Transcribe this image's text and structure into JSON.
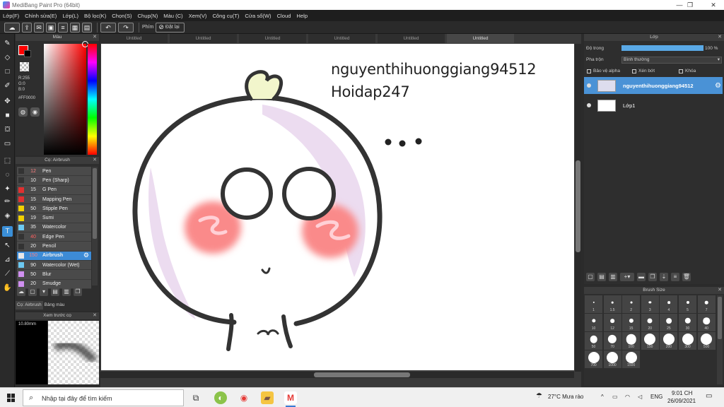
{
  "window": {
    "title": "MediBang Paint Pro (64bit)",
    "controls": [
      "—",
      "❐",
      "✕"
    ]
  },
  "menu": [
    "Lớp(F)",
    "Chỉnh sửa(E)",
    "Lớp(L)",
    "Bộ lọc(K)",
    "Chọn(S)",
    "Chụp(N)",
    "Màu (C)",
    "Xem(V)",
    "Công cụ(T)",
    "Cửa sổ(W)",
    "Cloud",
    "Help"
  ],
  "toolbar": {
    "hotkey_label": "Phím",
    "reset_label": "Đặt lại"
  },
  "color_panel": {
    "title": "Màu",
    "fg_color": "#ff0000",
    "bg_color": "#000000",
    "r": "R:255",
    "g": "G:0",
    "b": "B:0",
    "hex": "#FF0000"
  },
  "brush_panel": {
    "title": "Cọ: Airbrush",
    "brushes": [
      {
        "size": "12",
        "name": "Pen",
        "color": "#333333",
        "size_color": "#ff8080"
      },
      {
        "size": "10",
        "name": "Pen (Sharp)",
        "color": "#333333",
        "size_color": "#eeeeee"
      },
      {
        "size": "15",
        "name": "G Pen",
        "color": "#e03030",
        "size_color": "#eeeeee"
      },
      {
        "size": "15",
        "name": "Mapping Pen",
        "color": "#e03030",
        "size_color": "#eeeeee"
      },
      {
        "size": "50",
        "name": "Stipple Pen",
        "color": "#f0d000",
        "size_color": "#eeeeee"
      },
      {
        "size": "19",
        "name": "Sumi",
        "color": "#f0d000",
        "size_color": "#eeeeee"
      },
      {
        "size": "35",
        "name": "Watercolor",
        "color": "#6cc8f0",
        "size_color": "#eeeeee"
      },
      {
        "size": "40",
        "name": "Edge Pen",
        "color": "#333333",
        "size_color": "#ff6060"
      },
      {
        "size": "20",
        "name": "Pencil",
        "color": "#333333",
        "size_color": "#eeeeee"
      },
      {
        "size": "150",
        "name": "Airbrush",
        "color": "#e8e8e8",
        "size_color": "#ff8080"
      },
      {
        "size": "90",
        "name": "Watercolor (Wet)",
        "color": "#6cc8f0",
        "size_color": "#eeeeee"
      },
      {
        "size": "50",
        "name": "Blur",
        "color": "#d090f0",
        "size_color": "#eeeeee"
      },
      {
        "size": "20",
        "name": "Smudge",
        "color": "#d090f0",
        "size_color": "#eeeeee"
      }
    ],
    "tabs": [
      "Cọ: Airbrush",
      "Bảng màu"
    ]
  },
  "preview_panel": {
    "title": "Xem trước cọ",
    "size": "10.80mm"
  },
  "doc_tabs": [
    "Untitled",
    "Untitled",
    "Untitled",
    "Untitled",
    "Untitled",
    "Untitled"
  ],
  "canvas": {
    "text_line1": "nguyenthihuonggiang94512",
    "text_line2": "Hoidap247",
    "blush_color": "#fa8a8a",
    "stroke_color": "#333333",
    "shade_color": "#ead8ee"
  },
  "layer_panel": {
    "title": "Lớp",
    "opacity_label": "Độ trong",
    "opacity_value": "100 %",
    "opacity": 1.0,
    "blend_label": "Pha trộn",
    "blend_value": "Bình thường",
    "protect_alpha": "Bảo vệ alpha",
    "clipping": "Xén bớt",
    "lock": "Khóa",
    "layers": [
      {
        "name": "nguyenthihuonggiang94512",
        "selected": true
      },
      {
        "name": "Lớp1",
        "selected": false
      }
    ]
  },
  "brush_size_panel": {
    "title": "Brush Size",
    "sizes": [
      "1",
      "1.5",
      "2",
      "3",
      "4",
      "5",
      "7",
      "10",
      "12",
      "15",
      "20",
      "25",
      "30",
      "40",
      "50",
      "70",
      "100",
      "150",
      "200",
      "300",
      "500",
      "700",
      "1000",
      "1500"
    ]
  },
  "taskbar": {
    "search_placeholder": "Nhập tại đây để tìm kiếm",
    "weather": "27°C  Mưa rào",
    "lang": "ENG",
    "time": "9:01 CH",
    "date": "26/09/2021"
  }
}
